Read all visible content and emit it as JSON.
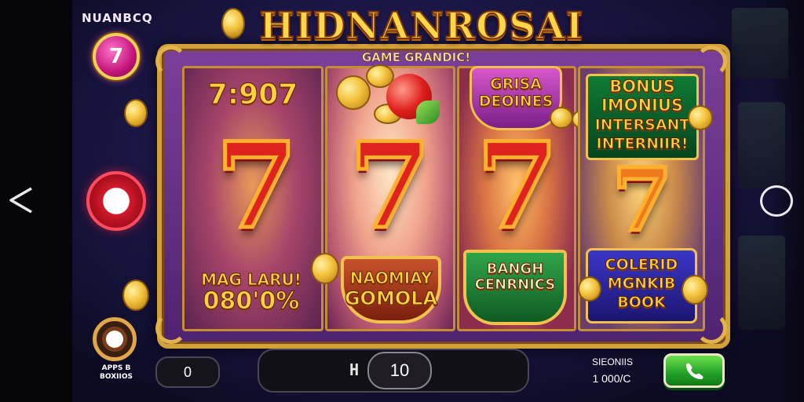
{
  "header": {
    "brand": "NUANBCQ",
    "title": "HIDNANROSAI",
    "subtitle": "GAME GRANDIC!"
  },
  "left_controls": {
    "profile_glyph": "7",
    "apps_label": "APPS B\nBOXIIOS"
  },
  "reels": {
    "reel1": {
      "top_text": "7:907",
      "symbol": "7",
      "bottom_line1": "MAG LARU!",
      "bottom_line2": "080'0%"
    },
    "reel2": {
      "symbol": "7",
      "badge_line1": "NAOMIAY",
      "badge_line2": "GOMOLA"
    },
    "reel3": {
      "badge_top_line1": "GRISA",
      "badge_top_line2": "DEOINES",
      "symbol": "7",
      "badge_bottom_line1": "BANGH",
      "badge_bottom_line2": "CENRNICS"
    },
    "reel4": {
      "badge_top_line1": "BONUS",
      "badge_top_line2": "IMONIUS",
      "badge_top_line3": "INTERSANT",
      "badge_top_line4": "INTERNIIR!",
      "symbol": "7",
      "badge_bottom_line1": "COLERID",
      "badge_bottom_line2": "MGNKIB",
      "badge_bottom_line3": "BOOK"
    }
  },
  "bottom_bar": {
    "balance_value": "0",
    "bet_icon": "H",
    "bet_value": "10",
    "stake_label": "SIEONIIS",
    "stake_value": "1 000/C",
    "spin_icon": "phone-icon"
  },
  "colors": {
    "gold": "#ffd23c",
    "seven_red": "#e0221f",
    "spin_green": "#22a028",
    "frame_purple": "#5a2a7e"
  }
}
